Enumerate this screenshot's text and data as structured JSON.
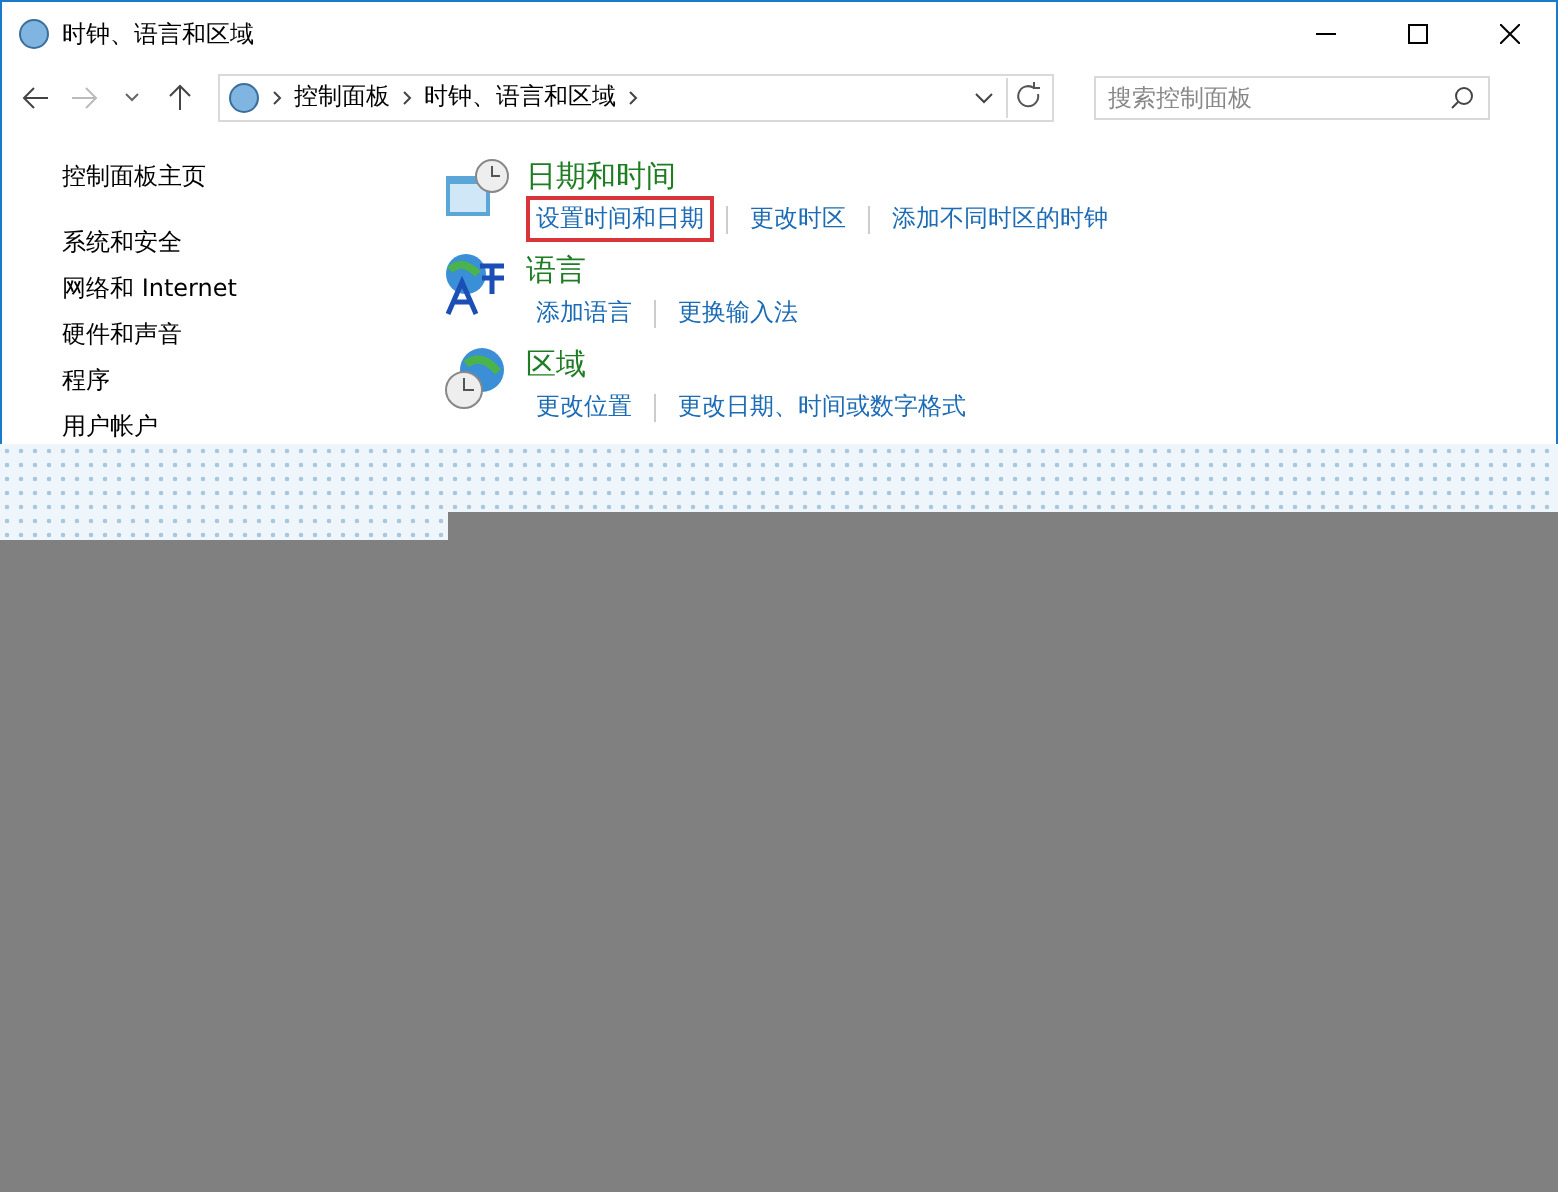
{
  "window": {
    "title": "时钟、语言和区域"
  },
  "address_bar": {
    "breadcrumbs": [
      "控制面板",
      "时钟、语言和区域"
    ]
  },
  "search": {
    "placeholder": "搜索控制面板"
  },
  "sidebar": {
    "home": "控制面板主页",
    "items": [
      "系统和安全",
      "网络和 Internet",
      "硬件和声音",
      "程序",
      "用户帐户"
    ]
  },
  "categories": [
    {
      "kind": "datetime",
      "title": "日期和时间",
      "links": [
        {
          "label": "设置时间和日期",
          "highlighted": true
        },
        {
          "label": "更改时区",
          "highlighted": false
        },
        {
          "label": "添加不同时区的时钟",
          "highlighted": false
        }
      ]
    },
    {
      "kind": "language",
      "title": "语言",
      "links": [
        {
          "label": "添加语言",
          "highlighted": false
        },
        {
          "label": "更换输入法",
          "highlighted": false
        }
      ]
    },
    {
      "kind": "region",
      "title": "区域",
      "links": [
        {
          "label": "更改位置",
          "highlighted": false
        },
        {
          "label": "更改日期、时间或数字格式",
          "highlighted": false
        }
      ]
    }
  ]
}
